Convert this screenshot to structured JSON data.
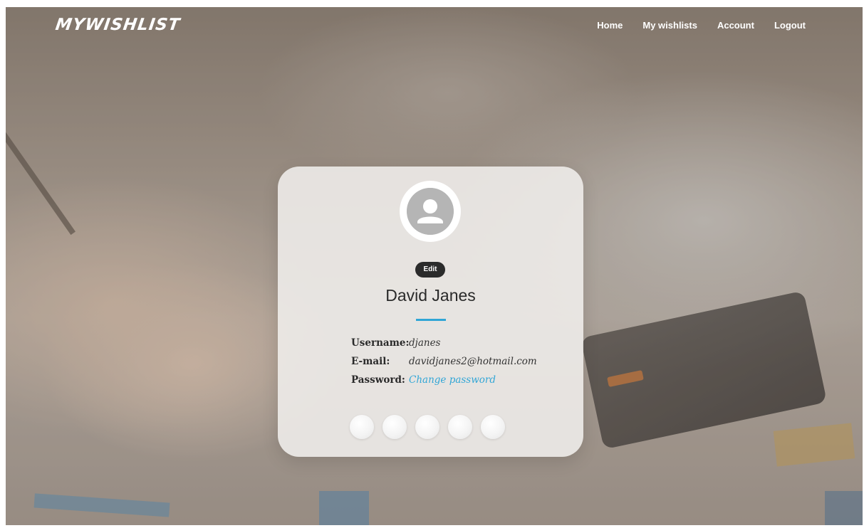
{
  "brand": {
    "name": "MYWISHLIST"
  },
  "nav": {
    "items": [
      {
        "label": "Home"
      },
      {
        "label": "My wishlists"
      },
      {
        "label": "Account"
      },
      {
        "label": "Logout"
      }
    ]
  },
  "profile": {
    "avatar_icon": "user-avatar-icon",
    "edit_label": "Edit",
    "name": "David Janes",
    "fields": {
      "username_label": "Username:",
      "username_value": "djanes",
      "email_label": "E-mail:",
      "email_value": "davidjanes2@hotmail.com",
      "password_label": "Password:",
      "password_link": "Change password"
    },
    "social_buttons": 5
  },
  "colors": {
    "accent": "#31a6d6",
    "edit_button": "#2b2b2b",
    "card": "#f0eeec"
  }
}
